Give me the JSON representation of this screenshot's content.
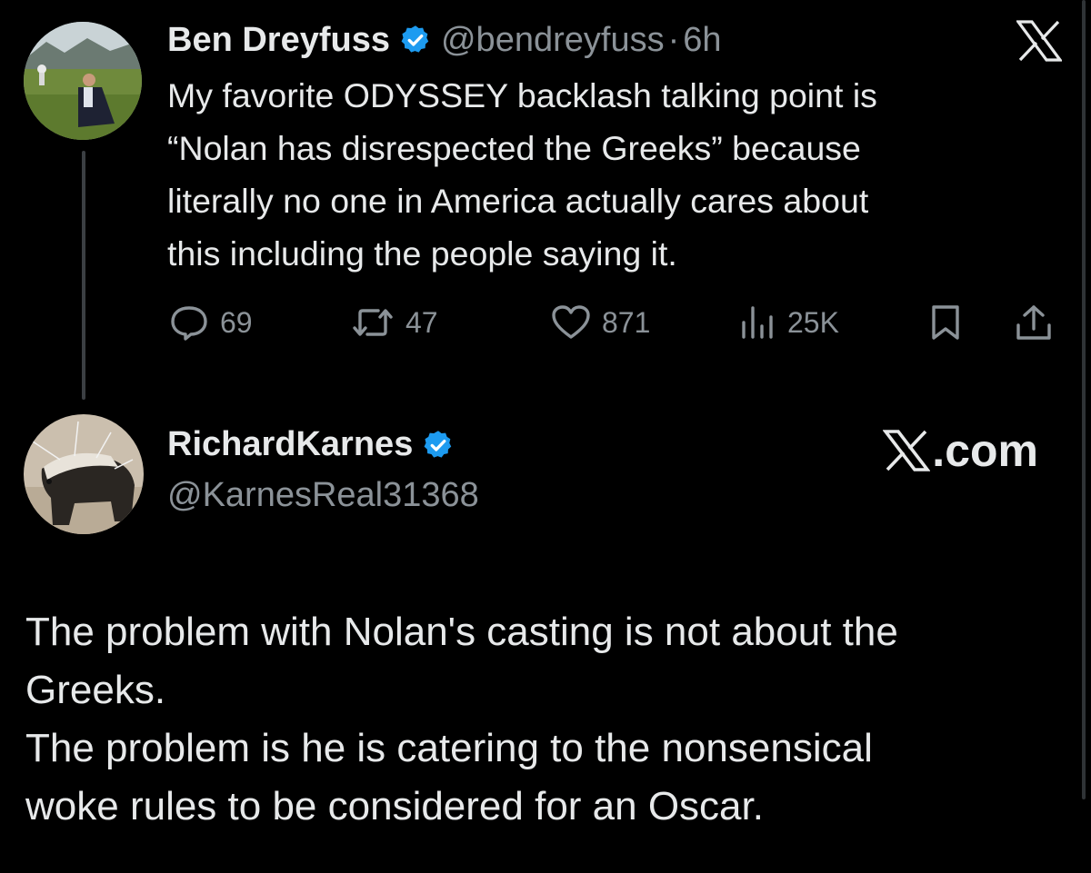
{
  "tweet1": {
    "author_name": "Ben Dreyfuss",
    "handle": "@bendreyfuss",
    "separator": "·",
    "time": "6h",
    "text_lines": [
      "My favorite ODYSSEY backlash talking point is",
      "“Nolan has disrespected the Greeks” because",
      "literally no one in America actually cares about",
      "this including the people saying it."
    ],
    "stats": {
      "replies": "69",
      "retweets": "47",
      "likes": "871",
      "views": "25K"
    }
  },
  "tweet2": {
    "author_name": "RichardKarnes",
    "handle": "@KarnesReal31368",
    "brand_suffix": ".com",
    "text_lines": [
      "The problem with Nolan's casting is not about the",
      "Greeks.",
      "The problem is he is catering to the nonsensical",
      "woke rules to be considered for an Oscar."
    ]
  },
  "colors": {
    "background": "#000000",
    "text": "#e7e9ea",
    "secondary": "#8b9298",
    "verified": "#1d9bf0"
  }
}
